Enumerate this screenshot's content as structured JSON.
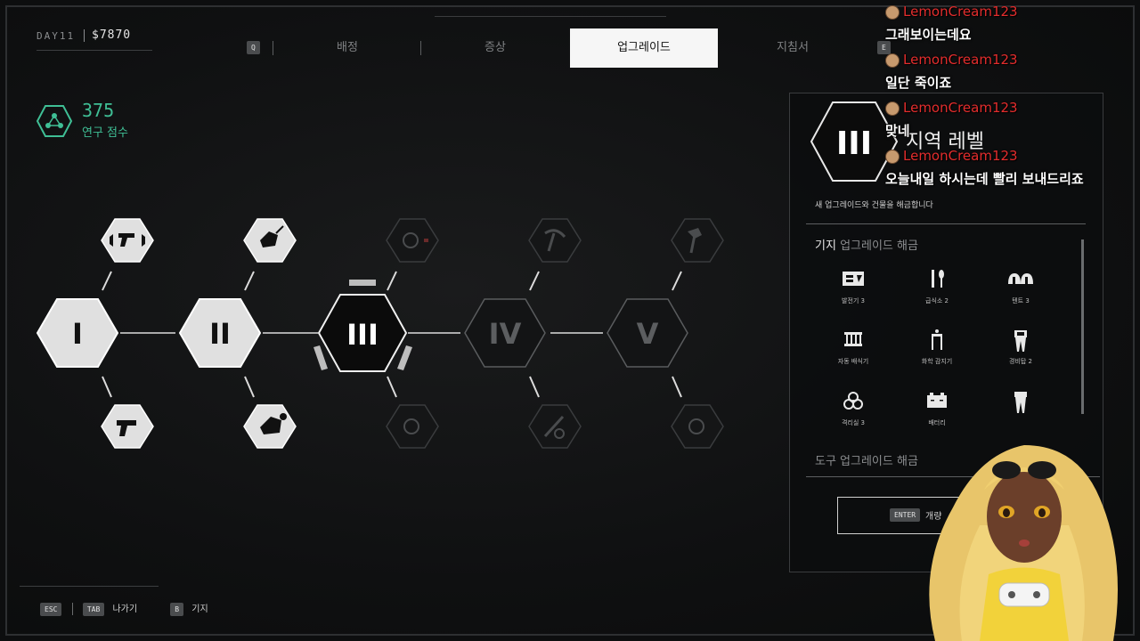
{
  "hud": {
    "day": "DAY11",
    "money": "$7870"
  },
  "tabs": {
    "key_left": "Q",
    "key_right": "E",
    "items": [
      {
        "label": "배정",
        "active": false
      },
      {
        "label": "증상",
        "active": false
      },
      {
        "label": "업그레이드",
        "active": true
      },
      {
        "label": "지침서",
        "active": false
      }
    ]
  },
  "research": {
    "value": "375",
    "label": "연구 점수",
    "color": "#3fbf95"
  },
  "tree": {
    "levels": [
      {
        "label": "I",
        "state": "unlocked"
      },
      {
        "label": "II",
        "state": "unlocked"
      },
      {
        "label": "III",
        "state": "selected"
      },
      {
        "label": "IV",
        "state": "locked"
      },
      {
        "label": "V",
        "state": "locked"
      }
    ],
    "upgrade_icons": {
      "top": [
        "gun-sound-icon",
        "fire-vehicle-icon",
        "grenade-icon",
        "pickaxe-icon",
        "axe-icon"
      ],
      "bottom": [
        "gun-icon",
        "vehicle-icon",
        "grenade-icon",
        "tools-icon",
        "grenade-icon"
      ]
    }
  },
  "panel": {
    "level_label": "III",
    "title": "지역 레벨",
    "description": "새 업그레이드와 건물을 해금합니다",
    "section1_prefix": "기지",
    "section1_suffix": "업그레이드 해금",
    "grid": [
      {
        "icon": "generator-icon",
        "label": "발전기 3"
      },
      {
        "icon": "cafeteria-icon",
        "label": "급식소 2"
      },
      {
        "icon": "tent-icon",
        "label": "텐트 3"
      },
      {
        "icon": "auto-fence-icon",
        "label": "자동 배식기"
      },
      {
        "icon": "fire-sensor-icon",
        "label": "화학 감지기"
      },
      {
        "icon": "watchtower-icon",
        "label": "경비탑 2"
      },
      {
        "icon": "biohazard-icon",
        "label": "격리실 3"
      },
      {
        "icon": "battery-icon",
        "label": "배터리"
      },
      {
        "icon": "tower-icon",
        "label": ""
      }
    ],
    "section2": "도구 업그레이드 해금",
    "enter_key": "ENTER",
    "enter_label": "개량"
  },
  "bottom_bar": {
    "esc": "ESC",
    "tab": "TAB",
    "exit_label": "나가기",
    "b": "B",
    "base_label": "기지"
  },
  "chat": [
    {
      "user": "LemonCream123",
      "text": "그래보이는데요"
    },
    {
      "user": "LemonCream123",
      "text": "일단 죽이죠"
    },
    {
      "user": "LemonCream123",
      "text": "맞네"
    },
    {
      "user": "LemonCream123",
      "text": "오늘내일 하시는데 빨리 보내드리죠"
    }
  ]
}
